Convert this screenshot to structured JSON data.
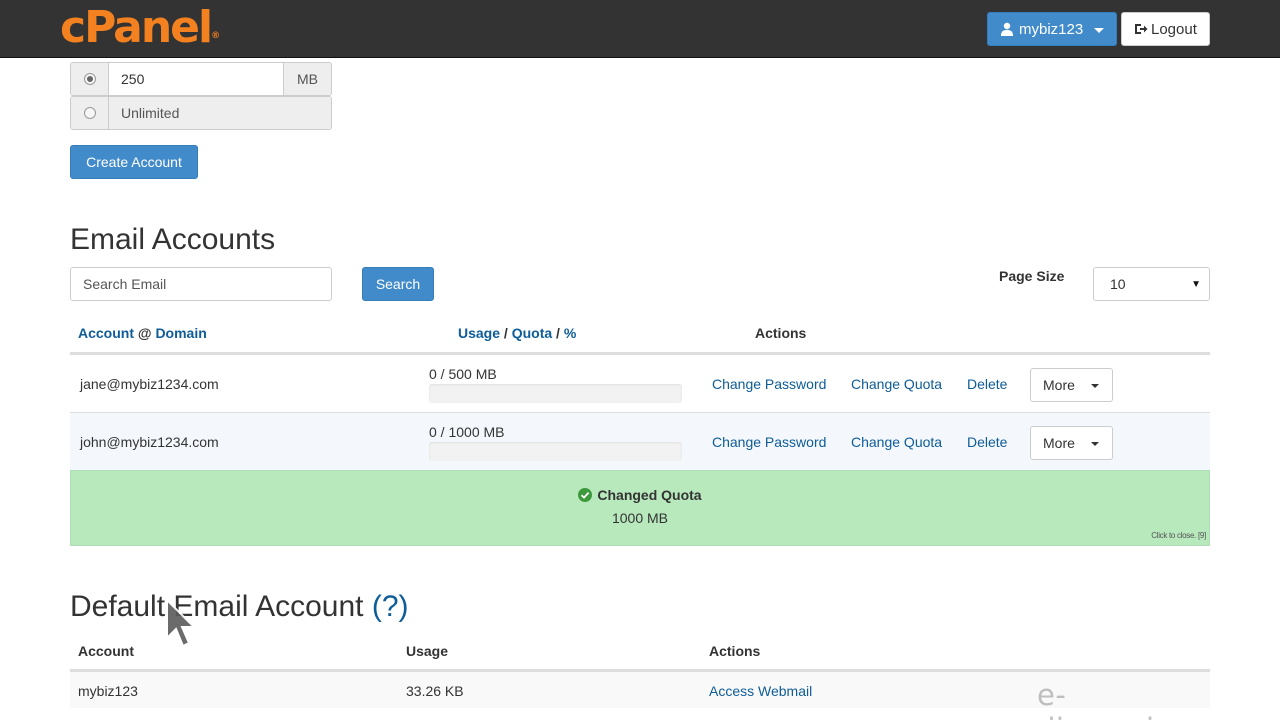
{
  "header": {
    "logo": "cPanel",
    "logo_mark": "®",
    "user_label": "mybiz123",
    "logout_label": "Logout"
  },
  "quota": {
    "value": "250",
    "unit": "MB",
    "unlimited_label": "Unlimited",
    "create_button": "Create Account"
  },
  "email_accounts": {
    "title": "Email Accounts",
    "search_placeholder": "Search Email",
    "search_button": "Search",
    "page_size_label": "Page Size",
    "page_size_value": "10",
    "columns": {
      "account": "Account",
      "at": "@",
      "domain": "Domain",
      "usage": "Usage",
      "slash": "/",
      "quota": "Quota",
      "percent": "%",
      "actions": "Actions"
    },
    "rows": [
      {
        "email": "jane@mybiz1234.com",
        "usage": "0 / 500 MB",
        "usage_fraction": 0,
        "change_password": "Change Password",
        "change_quota": "Change Quota",
        "delete": "Delete",
        "more": "More"
      },
      {
        "email": "john@mybiz1234.com",
        "usage": "0 / 1000 MB",
        "usage_fraction": 0,
        "change_password": "Change Password",
        "change_quota": "Change Quota",
        "delete": "Delete",
        "more": "More"
      }
    ]
  },
  "alert": {
    "title": "Changed Quota",
    "body": "1000 MB",
    "close_hint": "Click to close. [9]"
  },
  "default_account": {
    "title": "Default Email Account",
    "help": "(?)",
    "columns": {
      "account": "Account",
      "usage": "Usage",
      "actions": "Actions"
    },
    "row": {
      "account": "mybiz123",
      "usage": "33.26 KB",
      "action": "Access Webmail"
    }
  },
  "watermark": "e-dimensionz.com",
  "colors": {
    "navbar": "#333333",
    "logo": "#f48120",
    "primary": "#428bca",
    "link": "#0e5c98",
    "success_bg": "#b8e9bd",
    "success_icon": "#3c9a3c"
  }
}
